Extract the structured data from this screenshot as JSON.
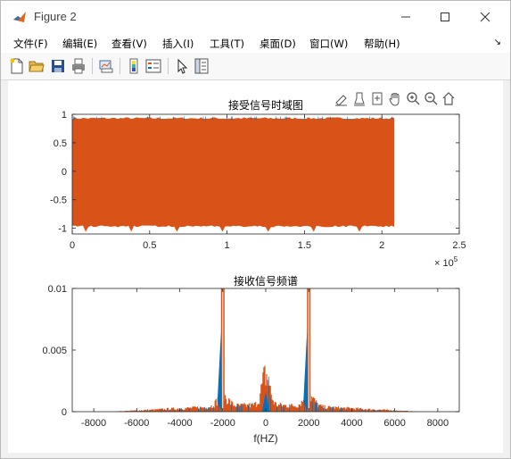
{
  "window": {
    "title": "Figure 2"
  },
  "menu": [
    "文件(F)",
    "编辑(E)",
    "查看(V)",
    "插入(I)",
    "工具(T)",
    "桌面(D)",
    "窗口(W)",
    "帮助(H)"
  ],
  "toolbar": [
    "new-figure",
    "open-file",
    "save",
    "print",
    "link-plot",
    "insert-colorbar",
    "insert-legend",
    "edit-plot",
    "property-inspector"
  ],
  "axes_toolbar": [
    "brush-icon",
    "data-tips-icon",
    "export-icon",
    "pan-icon",
    "zoom-in-icon",
    "zoom-out-icon",
    "home-icon"
  ],
  "colors": {
    "series1": "#0072bd",
    "series2": "#d95319"
  },
  "chart_data": [
    {
      "type": "area",
      "title": "接受信号时域图",
      "xlabel": "",
      "ylabel": "",
      "xlim": [
        0,
        250000
      ],
      "ylim": [
        -1.1,
        1
      ],
      "x_ticks": [
        0,
        0.5,
        1,
        1.5,
        2,
        2.5
      ],
      "y_ticks": [
        1,
        0.5,
        0,
        -0.5,
        -1
      ],
      "x_exponent": "× 10",
      "x_exponent_power": "5",
      "series": [
        {
          "envelope_upper": 0.92,
          "envelope_lower": -0.92,
          "x_end": 208000
        },
        {
          "envelope_upper": 0.95,
          "envelope_lower": -1.05,
          "x_end": 208000
        }
      ]
    },
    {
      "type": "line",
      "title": "接收信号频谱",
      "xlabel": "f(HZ)",
      "ylabel": "",
      "xlim": [
        -9000,
        9000
      ],
      "ylim": [
        0,
        0.01
      ],
      "x_ticks": [
        -8000,
        -6000,
        -4000,
        -2000,
        0,
        2000,
        4000,
        6000,
        8000
      ],
      "y_ticks": [
        "0.01",
        "0.005",
        "0"
      ],
      "peaks": [
        {
          "f": -2000,
          "value": 0.01
        },
        {
          "f": 2000,
          "value": 0.01
        },
        {
          "f": 0,
          "value": 0.0032
        }
      ]
    }
  ]
}
